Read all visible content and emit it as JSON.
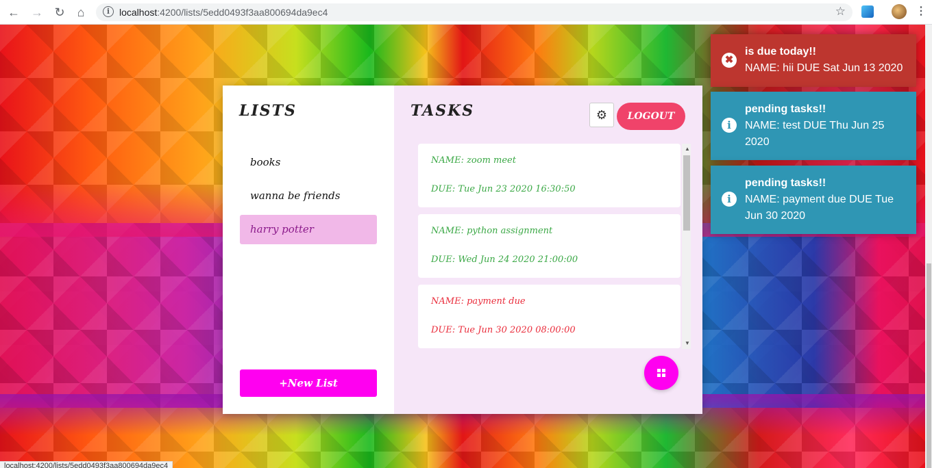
{
  "browser": {
    "url_host": "localhost",
    "url_path": ":4200/lists/5edd0493f3aa800694da9ec4",
    "status_url": "localhost:4200/lists/5edd0493f3aa800694da9ec4"
  },
  "lists_panel": {
    "title": "LISTS",
    "items": [
      {
        "label": "books",
        "active": false
      },
      {
        "label": "wanna be friends",
        "active": false
      },
      {
        "label": "harry potter",
        "active": true
      }
    ],
    "new_list_label": "+New List"
  },
  "tasks_panel": {
    "title": "TASKS",
    "logout_label": "LOGOUT",
    "tasks": [
      {
        "name": "NAME: zoom meet",
        "due": "DUE: Tue Jun 23 2020 16:30:50",
        "color": "#3aa845"
      },
      {
        "name": "NAME: python assignment",
        "due": "DUE: Wed Jun 24 2020 21:00:00",
        "color": "#3aa845"
      },
      {
        "name": "NAME: payment due",
        "due": "DUE: Tue Jun 30 2020 08:00:00",
        "color": "#ea2d3c"
      }
    ]
  },
  "toasts": [
    {
      "type": "error",
      "title": "is due today!!",
      "message": "NAME: hii DUE Sat Jun 13 2020",
      "icon": "error-circle-icon"
    },
    {
      "type": "info",
      "title": "pending tasks!!",
      "message": "NAME: test DUE Thu Jun 25 2020",
      "icon": "info-circle-icon"
    },
    {
      "type": "info",
      "title": "pending tasks!!",
      "message": "NAME: payment due DUE Tue Jun 30 2020",
      "icon": "info-circle-icon"
    }
  ],
  "colors": {
    "accent_magenta": "#ff00f0",
    "logout": "#f0436a",
    "toast_error": "#bd362f",
    "toast_info": "#2f96b4"
  }
}
